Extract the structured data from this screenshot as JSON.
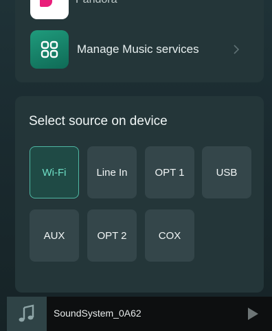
{
  "services": {
    "partial_item_label": "Pandora",
    "manage_label": "Manage Music services"
  },
  "source": {
    "title": "Select source on device",
    "selected": "Wi-Fi",
    "options": [
      "Wi-Fi",
      "Line In",
      "OPT 1",
      "USB",
      "AUX",
      "OPT 2",
      "COX"
    ]
  },
  "player": {
    "device_name": "SoundSystem_0A62"
  },
  "colors": {
    "accent": "#4fb8a4",
    "background": "#1b2a2f",
    "panel": "#243639",
    "button": "#34464a"
  },
  "icons": {
    "manage": "grid-icon",
    "chevron": "chevron-right-icon",
    "album": "music-note-icon",
    "play": "play-icon"
  }
}
